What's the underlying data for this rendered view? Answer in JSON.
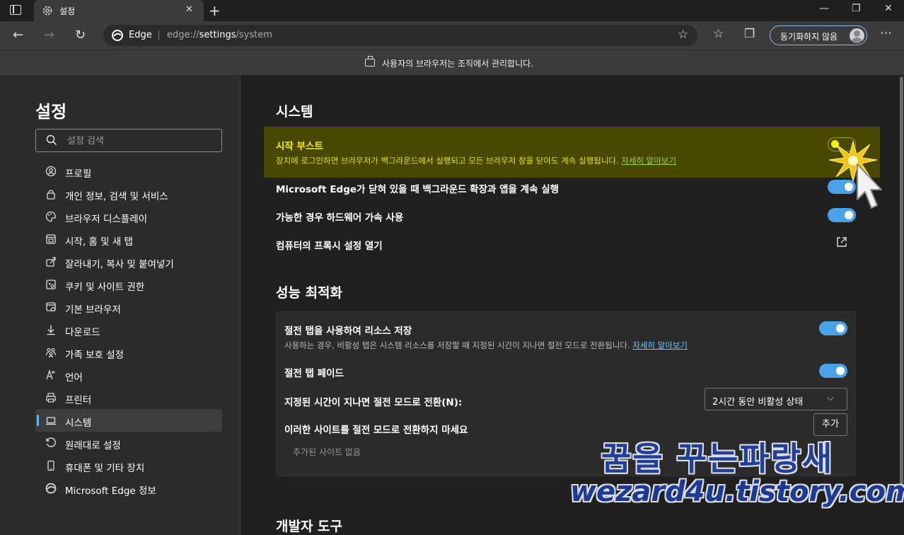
{
  "browser": {
    "tab_title": "설정",
    "address_brand": "Edge",
    "url_prefix": "edge://",
    "url_bold": "settings",
    "url_suffix": "/system",
    "sync_label": "동기화하지 않음",
    "managed_message": "사용자의 브라우저는 조직에서 관리합니다."
  },
  "sidebar": {
    "title": "설정",
    "search_placeholder": "설정 검색",
    "items": [
      {
        "label": "프로필",
        "icon": "profile-icon"
      },
      {
        "label": "개인 정보, 검색 및 서비스",
        "icon": "lock-icon"
      },
      {
        "label": "브라우저 디스플레이",
        "icon": "palette-icon"
      },
      {
        "label": "시작, 홈 및 새 탭",
        "icon": "home-tab-icon"
      },
      {
        "label": "잘라내기, 복사 및 붙여넣기",
        "icon": "share-icon"
      },
      {
        "label": "쿠키 및 사이트 권한",
        "icon": "cookie-icon"
      },
      {
        "label": "기본 브라우저",
        "icon": "browser-icon"
      },
      {
        "label": "다운로드",
        "icon": "download-icon"
      },
      {
        "label": "가족 보호 설정",
        "icon": "family-icon"
      },
      {
        "label": "언어",
        "icon": "language-icon"
      },
      {
        "label": "프린터",
        "icon": "printer-icon"
      },
      {
        "label": "시스템",
        "icon": "laptop-icon"
      },
      {
        "label": "원래대로 설정",
        "icon": "reset-icon"
      },
      {
        "label": "휴대폰 및 기타 장치",
        "icon": "phone-icon"
      },
      {
        "label": "Microsoft Edge 정보",
        "icon": "edge-logo-icon"
      }
    ],
    "active_index": 11
  },
  "system": {
    "title": "시스템",
    "startup_boost": {
      "title": "시작 부스트",
      "desc": "장치에 로그인하면 브라우저가 백그라운드에서 실행되고 모든 브라우저 창을 닫아도 계속 실행됩니다.",
      "link": "자세히 알아보기",
      "enabled": false
    },
    "background_ext": {
      "title": "Microsoft Edge가 닫혀 있을 때 백그라운드 확장과 앱을 계속 실행",
      "enabled": true
    },
    "hardware_accel": {
      "title": "가능한 경우 하드웨어 가속 사용",
      "enabled": true
    },
    "proxy": {
      "title": "컴퓨터의 프록시 설정 열기"
    }
  },
  "performance": {
    "title": "성능 최적화",
    "sleeping_tabs": {
      "title": "절전 탭을 사용하여 리소스 저장",
      "desc": "사용하는 경우, 비활성 탭은 시스템 리소스를 저장할 때 지정된 시간이 지나면 절전 모드로 전환됩니다.",
      "link": "자세히 알아보기",
      "enabled": true
    },
    "fade": {
      "title": "절전 탭 페이드",
      "enabled": true
    },
    "timeout": {
      "title": "지정된 시간이 지나면 절전 모드로 전환(N):",
      "value": "2시간 동안 비활성 상태"
    },
    "never_sleep": {
      "title": "이러한 사이트를 절전 모드로 전환하지 마세요",
      "add_label": "추가",
      "empty": "추가된 사이트 없음"
    }
  },
  "devtools": {
    "title": "개발자 도구"
  },
  "watermark": {
    "line1": "꿈을 꾸는파랑새",
    "line2": "wezard4u.tistory.com"
  },
  "colors": {
    "accent": "#4aa3e8",
    "highlight": "#494800",
    "highlight_text": "#f5f000"
  }
}
